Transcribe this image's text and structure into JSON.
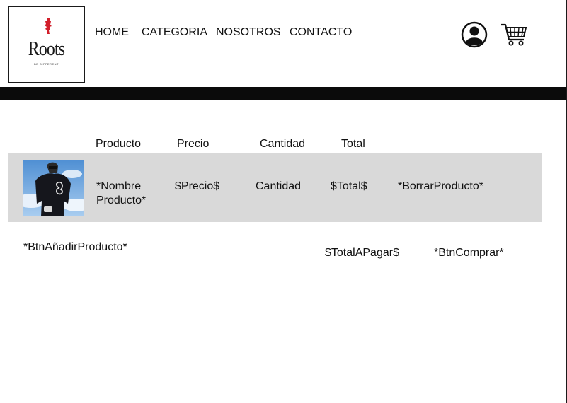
{
  "brand": {
    "name": "Roots",
    "tagline": "BE DIFFERENT"
  },
  "nav": {
    "home": "HOME",
    "categoria": "CATEGORIA",
    "nosotros": "NOSOTROS",
    "contacto": "CONTACTO"
  },
  "icons": {
    "account": "user-circle-icon",
    "cart": "shopping-cart-icon"
  },
  "cart": {
    "headers": {
      "producto": "Producto",
      "precio": "Precio",
      "cantidad": "Cantidad",
      "total": "Total"
    },
    "item": {
      "name_line1": "*Nombre",
      "name_line2": "Producto*",
      "price": "$Precio$",
      "quantity": "Cantidad",
      "total": "$Total$",
      "delete": "*BorrarProducto*"
    },
    "add_product": "*BtnAñadirProducto*",
    "total_to_pay": "$TotalAPagar$",
    "buy": "*BtnComprar*"
  },
  "colors": {
    "row_bg": "#d9d9d9",
    "bar": "#0b0b0b",
    "logo_red": "#d21f2b"
  }
}
